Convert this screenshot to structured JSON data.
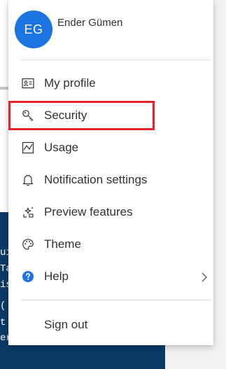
{
  "colors": {
    "avatar_bg": "#1b74e0",
    "highlight": "#e3242b",
    "help_icon": "#1b74e0",
    "background_panel": "#0b3a67"
  },
  "user": {
    "initials": "EG",
    "name": "Ender Gümen"
  },
  "menu": {
    "items": [
      {
        "label": "My profile",
        "icon": "contact-card-icon"
      },
      {
        "label": "Security",
        "icon": "key-icon",
        "highlighted": true
      },
      {
        "label": "Usage",
        "icon": "chart-icon"
      },
      {
        "label": "Notification settings",
        "icon": "bell-icon"
      },
      {
        "label": "Preview features",
        "icon": "preview-sparkle-icon"
      },
      {
        "label": "Theme",
        "icon": "palette-icon"
      },
      {
        "label": "Help",
        "icon": "help-icon",
        "has_submenu": true
      }
    ],
    "sign_out_label": "Sign out"
  },
  "background": {
    "code_lines": [
      "ui",
      "Ta",
      "is",
      "(",
      "t",
      "er"
    ]
  }
}
